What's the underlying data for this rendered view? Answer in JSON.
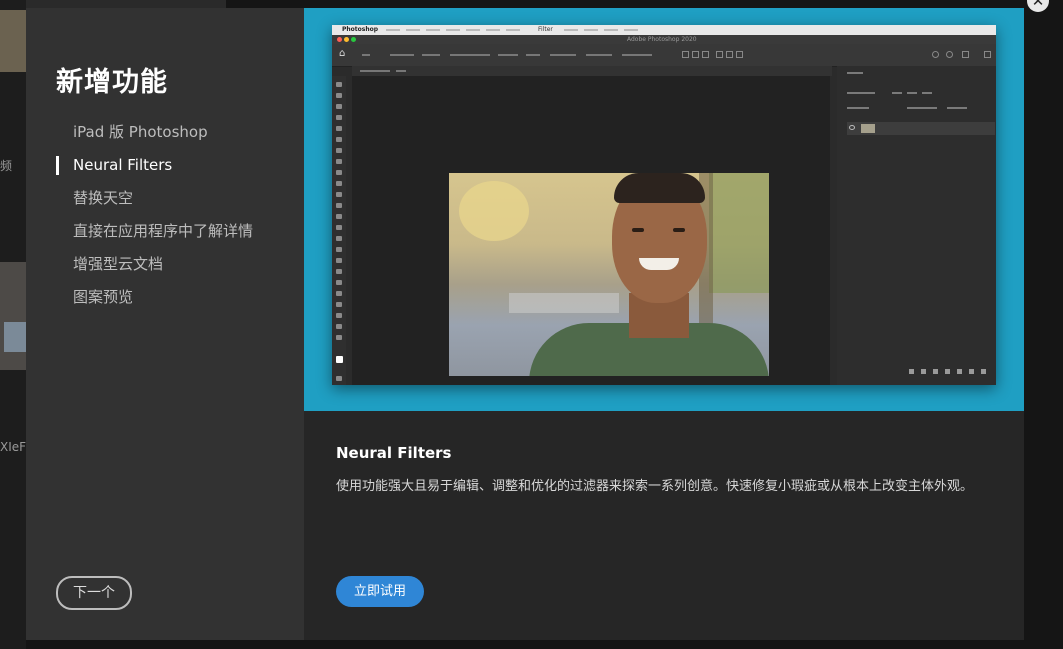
{
  "background": {
    "text_1": "频",
    "text_2": "XIeF"
  },
  "dialog": {
    "title": "新增功能",
    "nav_items": [
      {
        "label": "iPad 版 Photoshop",
        "active": false
      },
      {
        "label": "Neural Filters",
        "active": true
      },
      {
        "label": "替换天空",
        "active": false
      },
      {
        "label": "直接在应用程序中了解详情",
        "active": false
      },
      {
        "label": "增强型云文档",
        "active": false
      },
      {
        "label": "图案预览",
        "active": false
      }
    ],
    "next_button": "下一个",
    "close_icon": "close-icon",
    "preview": {
      "app_name": "Photoshop",
      "menu_filter": "Filter",
      "window_title": "Adobe Photoshop 2020",
      "frame_color": "#1f9fc3"
    },
    "feature": {
      "title": "Neural Filters",
      "description": "使用功能强大且易于编辑、调整和优化的过滤器来探索一系列创意。快速修复小瑕疵或从根本上改变主体外观。",
      "try_button": "立即试用",
      "accent_color": "#2f86d6"
    }
  }
}
